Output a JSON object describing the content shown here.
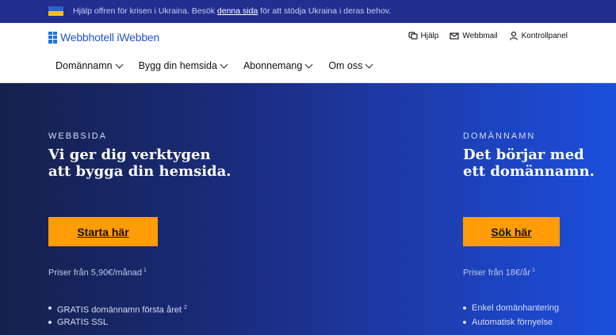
{
  "banner": {
    "text_before": "Hjälp offren för krisen i Ukraina. Besök ",
    "link": "denna sida",
    "text_after": " för att stödja Ukraina i deras behov."
  },
  "header": {
    "logo_text": "Webbhotell iWebben",
    "util_links": [
      {
        "label": "Hjälp",
        "icon": "help-icon"
      },
      {
        "label": "Webbmail",
        "icon": "mail-icon"
      },
      {
        "label": "Kontrollpanel",
        "icon": "user-icon"
      }
    ],
    "nav": [
      {
        "label": "Domännamn"
      },
      {
        "label": "Bygg din hemsida"
      },
      {
        "label": "Abonnemang"
      },
      {
        "label": "Om oss"
      }
    ]
  },
  "hero": {
    "left": {
      "eyebrow": "WEBBSIDA",
      "headline_line1": "Vi ger dig verktygen",
      "headline_line2": "att bygga din hemsida.",
      "cta": "Starta här",
      "price": "Priser från 5,90€/månad",
      "price_note": "1",
      "features": [
        {
          "text": "GRATIS domännamn första året",
          "note": "2"
        },
        {
          "text": "GRATIS SSL",
          "note": ""
        }
      ]
    },
    "right": {
      "eyebrow": "DOMÄNNAMN",
      "headline_line1": "Det börjar med",
      "headline_line2": "ett domännamn.",
      "cta": "Sök här",
      "price": "Priser från 18€/år",
      "price_note": "1",
      "features": [
        {
          "text": "Enkel domänhantering"
        },
        {
          "text": "Automatisk förnyelse"
        }
      ]
    }
  },
  "colors": {
    "banner_bg": "#232f8f",
    "cta_bg": "#ff9c08",
    "logo_blue": "#1f55c9"
  }
}
